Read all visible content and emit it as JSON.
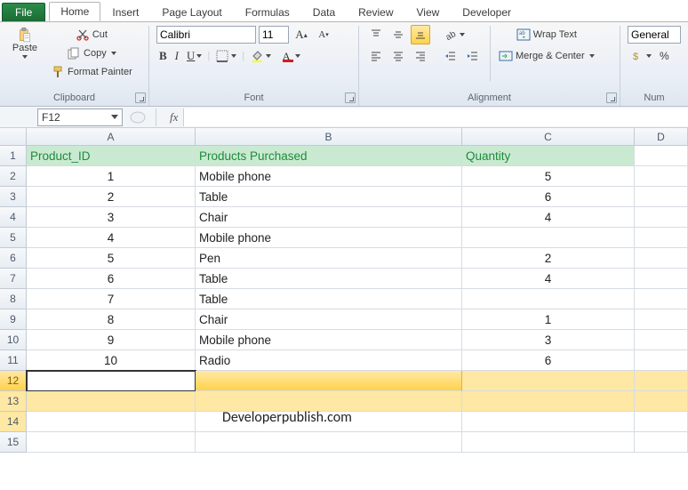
{
  "tabs": {
    "file": "File",
    "items": [
      "Home",
      "Insert",
      "Page Layout",
      "Formulas",
      "Data",
      "Review",
      "View",
      "Developer"
    ],
    "active": "Home"
  },
  "ribbon": {
    "clipboard": {
      "label": "Clipboard",
      "paste": "Paste",
      "cut": "Cut",
      "copy": "Copy",
      "format_painter": "Format Painter"
    },
    "font": {
      "label": "Font",
      "font_name": "Calibri",
      "font_size": "11"
    },
    "alignment": {
      "label": "Alignment",
      "wrap": "Wrap Text",
      "merge": "Merge & Center"
    },
    "number": {
      "label": "Num",
      "format": "General"
    }
  },
  "formula_bar": {
    "name_box": "F12",
    "fx_label": "fx",
    "formula": ""
  },
  "columns": [
    "A",
    "B",
    "C",
    "D"
  ],
  "rows": [
    "1",
    "2",
    "3",
    "4",
    "5",
    "6",
    "7",
    "8",
    "9",
    "10",
    "11",
    "12",
    "13",
    "14",
    "15"
  ],
  "chart_data": {
    "type": "table",
    "title": "",
    "headers": [
      "Product_ID",
      "Products Purchased",
      "Quantity"
    ],
    "records": [
      {
        "id": "1",
        "product": "Mobile phone",
        "qty": "5"
      },
      {
        "id": "2",
        "product": "Table",
        "qty": "6"
      },
      {
        "id": "3",
        "product": "Chair",
        "qty": "4"
      },
      {
        "id": "4",
        "product": "Mobile phone",
        "qty": ""
      },
      {
        "id": "5",
        "product": "Pen",
        "qty": "2"
      },
      {
        "id": "6",
        "product": "Table",
        "qty": "4"
      },
      {
        "id": "7",
        "product": "Table",
        "qty": ""
      },
      {
        "id": "8",
        "product": "Chair",
        "qty": "1"
      },
      {
        "id": "9",
        "product": "Mobile phone",
        "qty": "3"
      },
      {
        "id": "10",
        "product": "Radio",
        "qty": "6"
      }
    ]
  },
  "watermark": "Developerpublish.com"
}
